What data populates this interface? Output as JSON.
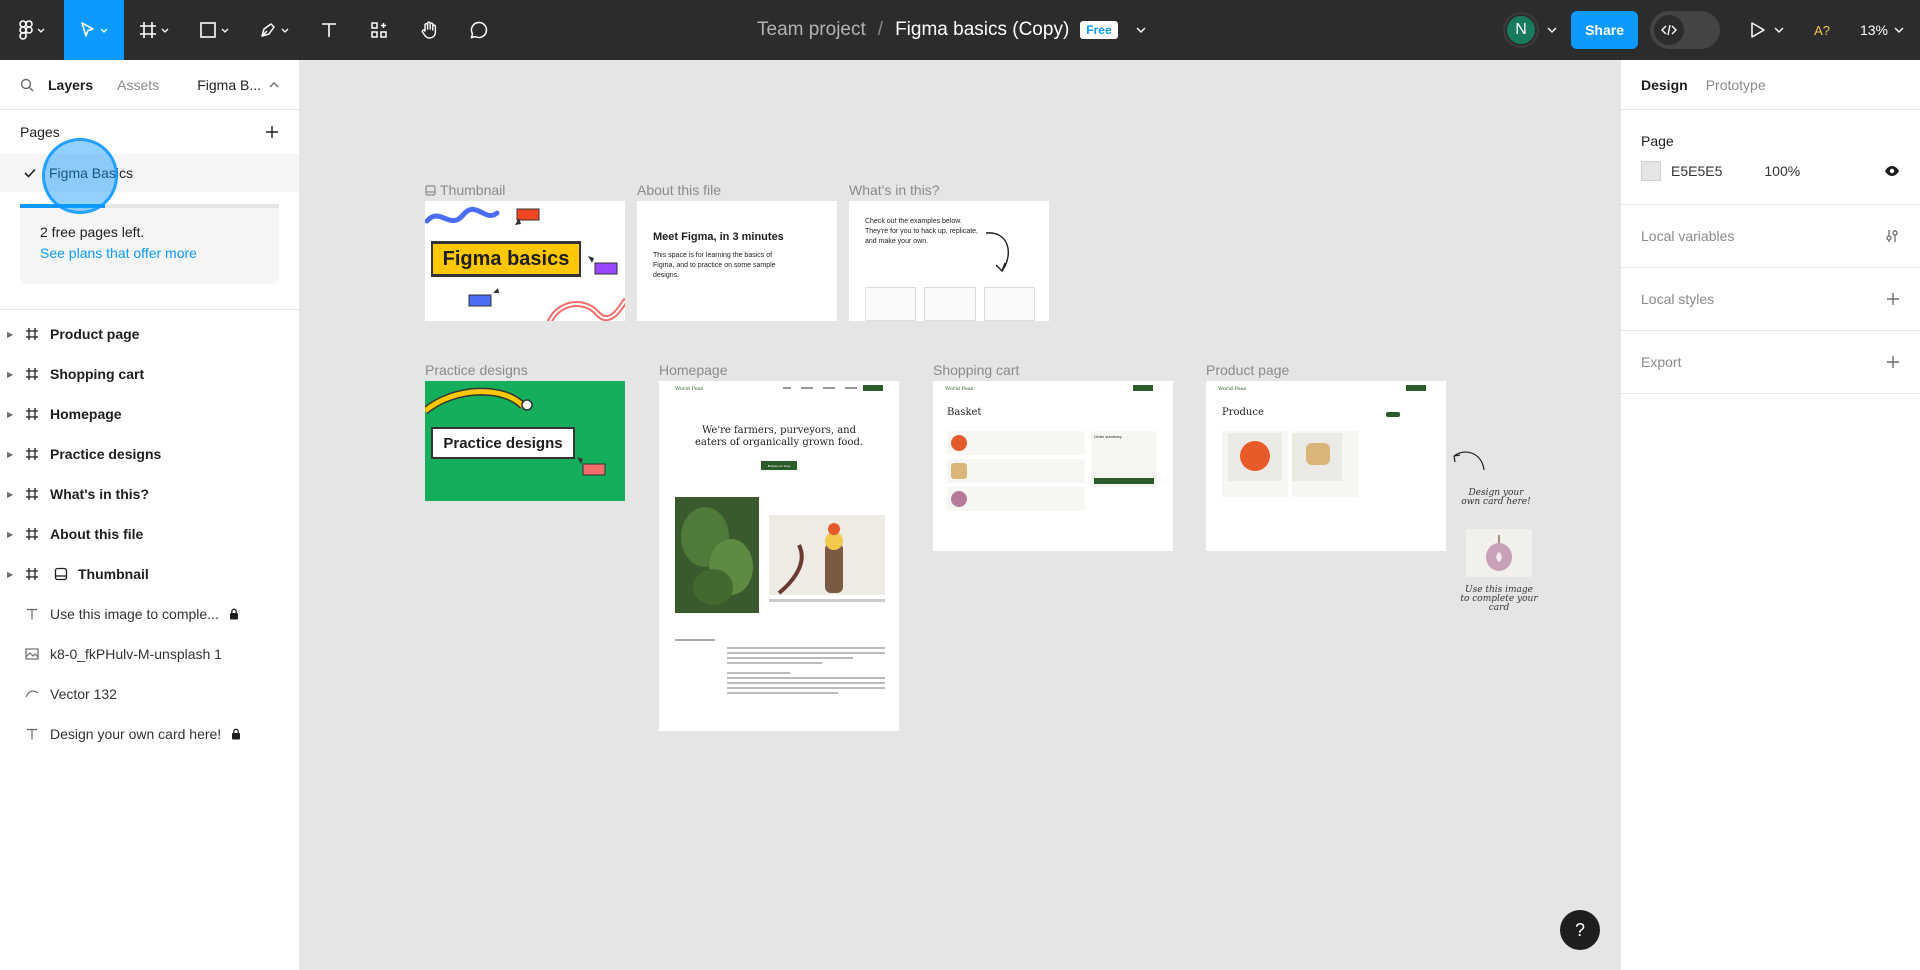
{
  "topbar": {
    "project": "Team project",
    "file_name": "Figma basics (Copy)",
    "plan_badge": "Free",
    "user_initial": "N",
    "share_label": "Share",
    "a11y_label": "A?",
    "zoom": "13%"
  },
  "left": {
    "tabs": {
      "layers": "Layers",
      "assets": "Assets",
      "file": "Figma B..."
    },
    "pages_heading": "Pages",
    "current_page": "Figma Basics",
    "free_pages": "2 free pages left.",
    "plans_link": "See plans that offer more",
    "free_pages_used_fraction": 0.33,
    "layers": [
      {
        "name": "Product page",
        "type": "frame"
      },
      {
        "name": "Shopping cart",
        "type": "frame"
      },
      {
        "name": "Homepage",
        "type": "frame"
      },
      {
        "name": "Practice designs",
        "type": "frame"
      },
      {
        "name": "What's in this?",
        "type": "frame"
      },
      {
        "name": "About this file",
        "type": "frame"
      },
      {
        "name": "Thumbnail",
        "type": "frame-thumbnail"
      },
      {
        "name": "Use this image to comple...",
        "type": "text",
        "locked": true
      },
      {
        "name": "k8-0_fkPHulv-M-unsplash 1",
        "type": "image"
      },
      {
        "name": "Vector 132",
        "type": "vector"
      },
      {
        "name": "Design your own card here!",
        "type": "text",
        "locked": true
      }
    ]
  },
  "right": {
    "tabs": {
      "design": "Design",
      "prototype": "Prototype"
    },
    "page_heading": "Page",
    "page_color_hex": "E5E5E5",
    "page_opacity": "100%",
    "local_variables": "Local variables",
    "local_styles": "Local styles",
    "export": "Export"
  },
  "canvas": {
    "labels": {
      "thumbnail": "Thumbnail",
      "about": "About this file",
      "whats_in": "What's in this?",
      "practice": "Practice designs",
      "homepage": "Homepage",
      "shopping": "Shopping cart",
      "product": "Product page"
    },
    "thumbnail_title": "Figma basics",
    "about_heading": "Meet Figma, in 3 minutes",
    "about_body": "This space is for learning the basics of Figma, and to practice on some sample designs.",
    "whats_in_body": "Check out the examples below. They're for you to hack up, replicate, and make your own.",
    "practice_title": "Practice designs",
    "homepage_brand": "World Peas",
    "homepage_headline": "We're farmers, purveyors, and eaters of organically grown food.",
    "homepage_cta": "Browse our shop",
    "basket_title": "Basket",
    "order_summary": "Order summary",
    "produce_title": "Produce",
    "card_note": "Design your own card here!",
    "image_note": "Use this image to complete your card"
  },
  "help_label": "?"
}
